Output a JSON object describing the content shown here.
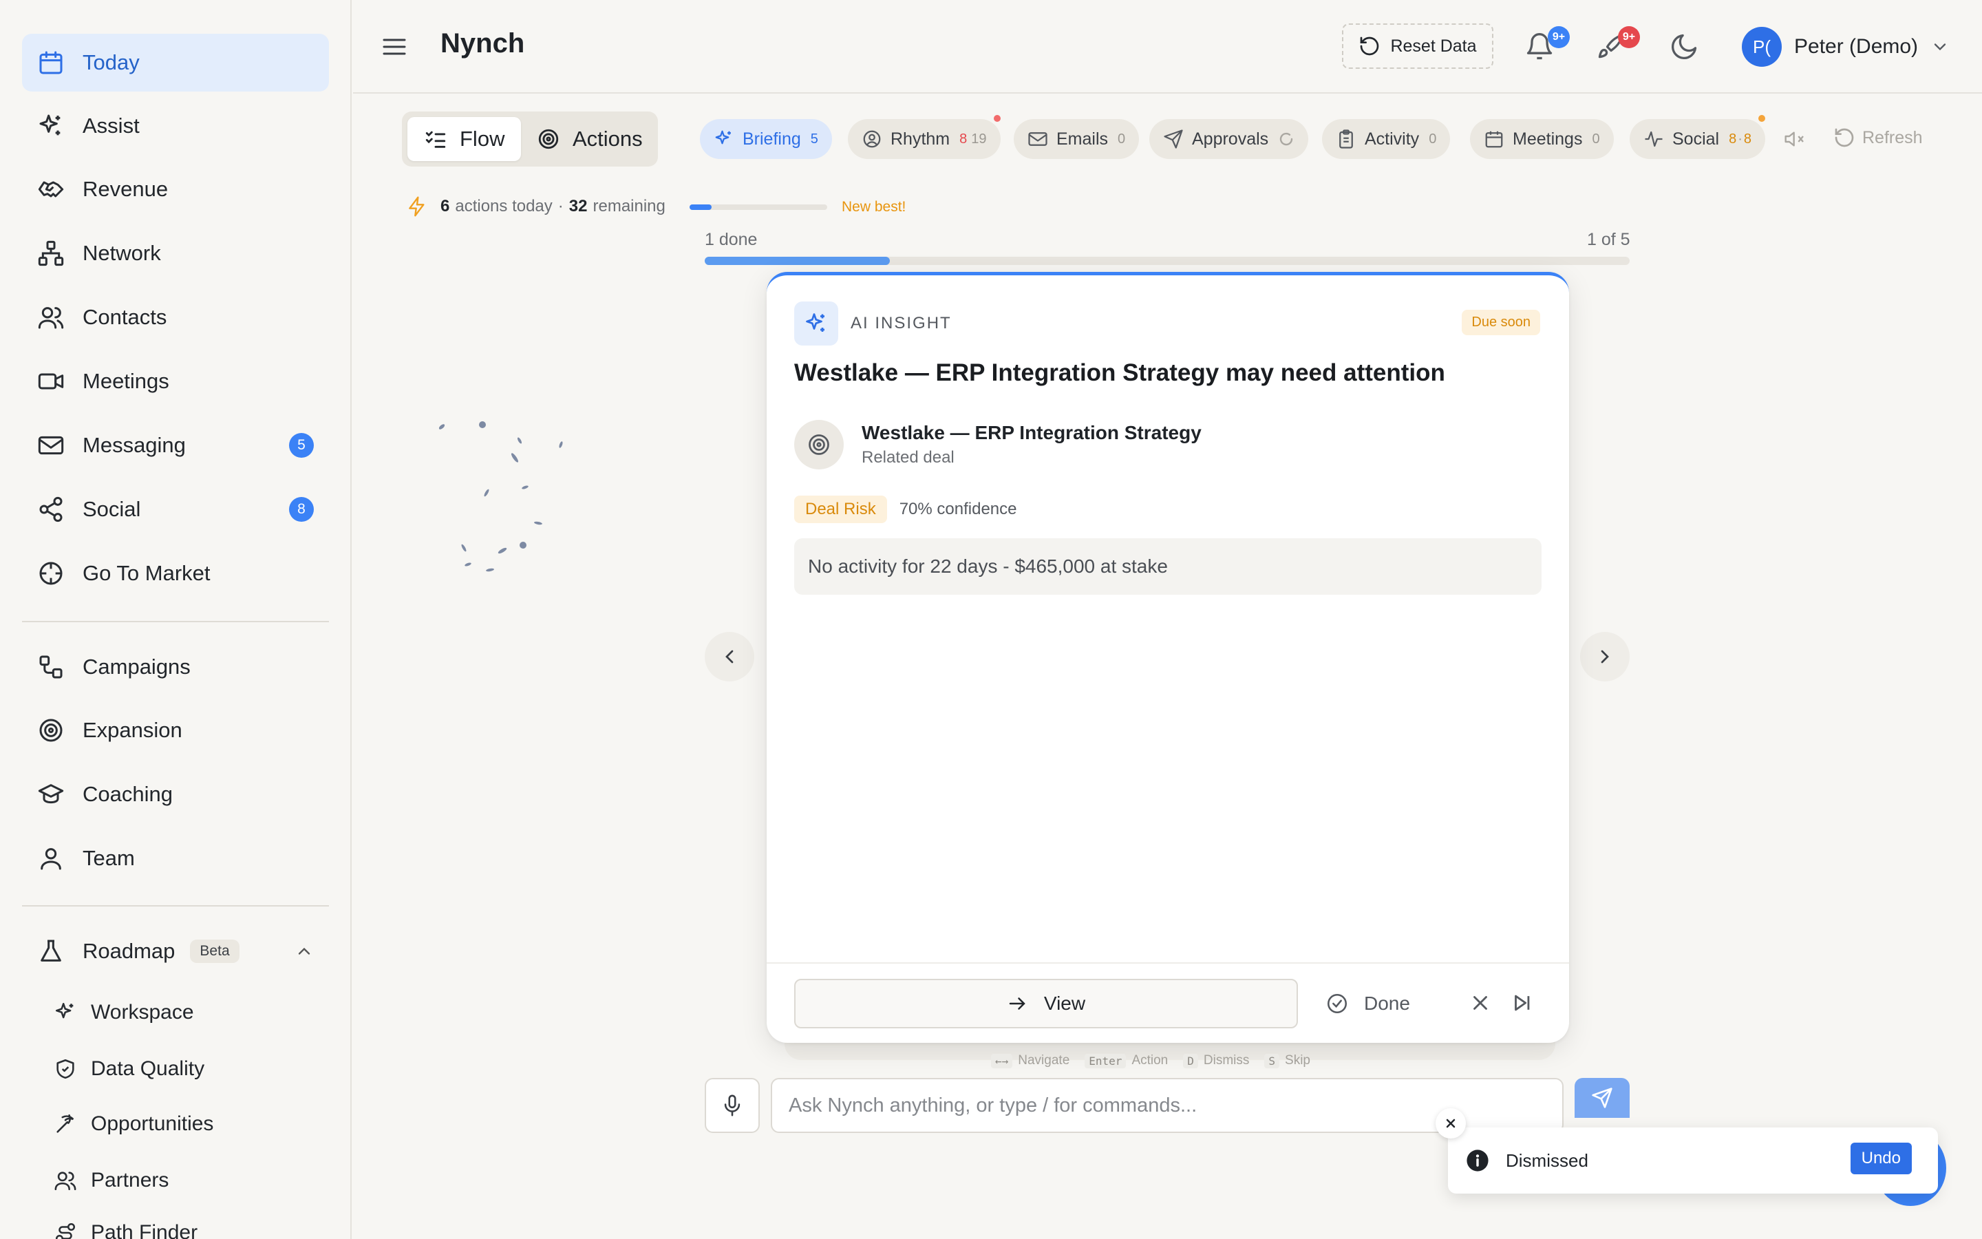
{
  "sidebar": {
    "items": [
      {
        "label": "Today",
        "icon": "calendar-icon"
      },
      {
        "label": "Assist",
        "icon": "sparkles-icon"
      },
      {
        "label": "Revenue",
        "icon": "handshake-icon"
      },
      {
        "label": "Network",
        "icon": "network-icon"
      },
      {
        "label": "Contacts",
        "icon": "users-icon"
      },
      {
        "label": "Meetings",
        "icon": "video-icon"
      },
      {
        "label": "Messaging",
        "icon": "mail-icon",
        "badge": "5"
      },
      {
        "label": "Social",
        "icon": "share-icon",
        "badge": "8"
      },
      {
        "label": "Go To Market",
        "icon": "crosshair-icon"
      }
    ],
    "items2": [
      {
        "label": "Campaigns",
        "icon": "workflow-icon"
      },
      {
        "label": "Expansion",
        "icon": "target-icon"
      },
      {
        "label": "Coaching",
        "icon": "graduation-cap-icon"
      },
      {
        "label": "Team",
        "icon": "user-icon"
      }
    ],
    "roadmap": {
      "label": "Roadmap",
      "badge": "Beta"
    },
    "roadmap_items": [
      {
        "label": "Workspace",
        "icon": "sparkles-icon"
      },
      {
        "label": "Data Quality",
        "icon": "shield-check-icon"
      },
      {
        "label": "Opportunities",
        "icon": "pickaxe-icon"
      },
      {
        "label": "Partners",
        "icon": "users-icon"
      },
      {
        "label": "Path Finder",
        "icon": "route-icon"
      }
    ]
  },
  "header": {
    "title": "Nynch",
    "reset_label": "Reset Data",
    "notif_badge": "9+",
    "alerts_badge": "9+",
    "user_initials": "P(",
    "user_name": "Peter (Demo)"
  },
  "toolbar": {
    "flow_label": "Flow",
    "actions_label": "Actions",
    "pills": [
      {
        "label": "Briefing",
        "count": "5"
      },
      {
        "label": "Rhythm",
        "count_hot": "8",
        "count": "19"
      },
      {
        "label": "Emails",
        "count": "0"
      },
      {
        "label": "Approvals"
      },
      {
        "label": "Activity",
        "count": "0"
      },
      {
        "label": "Meetings",
        "count": "0"
      },
      {
        "label": "Social",
        "count_warm": "8",
        "count": "8"
      }
    ],
    "refresh_label": "Refresh"
  },
  "stats": {
    "actions_count": "6",
    "actions_label": "actions today",
    "separator": "·",
    "remaining_count": "32",
    "remaining_label": "remaining",
    "new_best": "New best!",
    "mini_progress_pct": 16
  },
  "progress": {
    "done_label": "1 done",
    "position_label": "1 of 5",
    "fraction": 0.2
  },
  "card": {
    "tag": "AI INSIGHT",
    "due": "Due soon",
    "title": "Westlake — ERP Integration Strategy may need attention",
    "deal_name": "Westlake — ERP Integration Strategy",
    "deal_sub": "Related deal",
    "risk_label": "Deal Risk",
    "confidence": "70% confidence",
    "insight": "No activity for 22 days - $465,000 at stake",
    "view_label": "View",
    "done_label": "Done"
  },
  "shortcuts": [
    {
      "key": "←→",
      "label": "Navigate"
    },
    {
      "key": "Enter",
      "label": "Action"
    },
    {
      "key": "D",
      "label": "Dismiss"
    },
    {
      "key": "S",
      "label": "Skip"
    }
  ],
  "command": {
    "placeholder": "Ask Nynch anything, or type / for commands..."
  },
  "toast": {
    "message": "Dismissed",
    "undo_label": "Undo"
  },
  "colors": {
    "accent": "#3b82f6",
    "warning": "#d98a0b",
    "danger": "#e5484d"
  }
}
